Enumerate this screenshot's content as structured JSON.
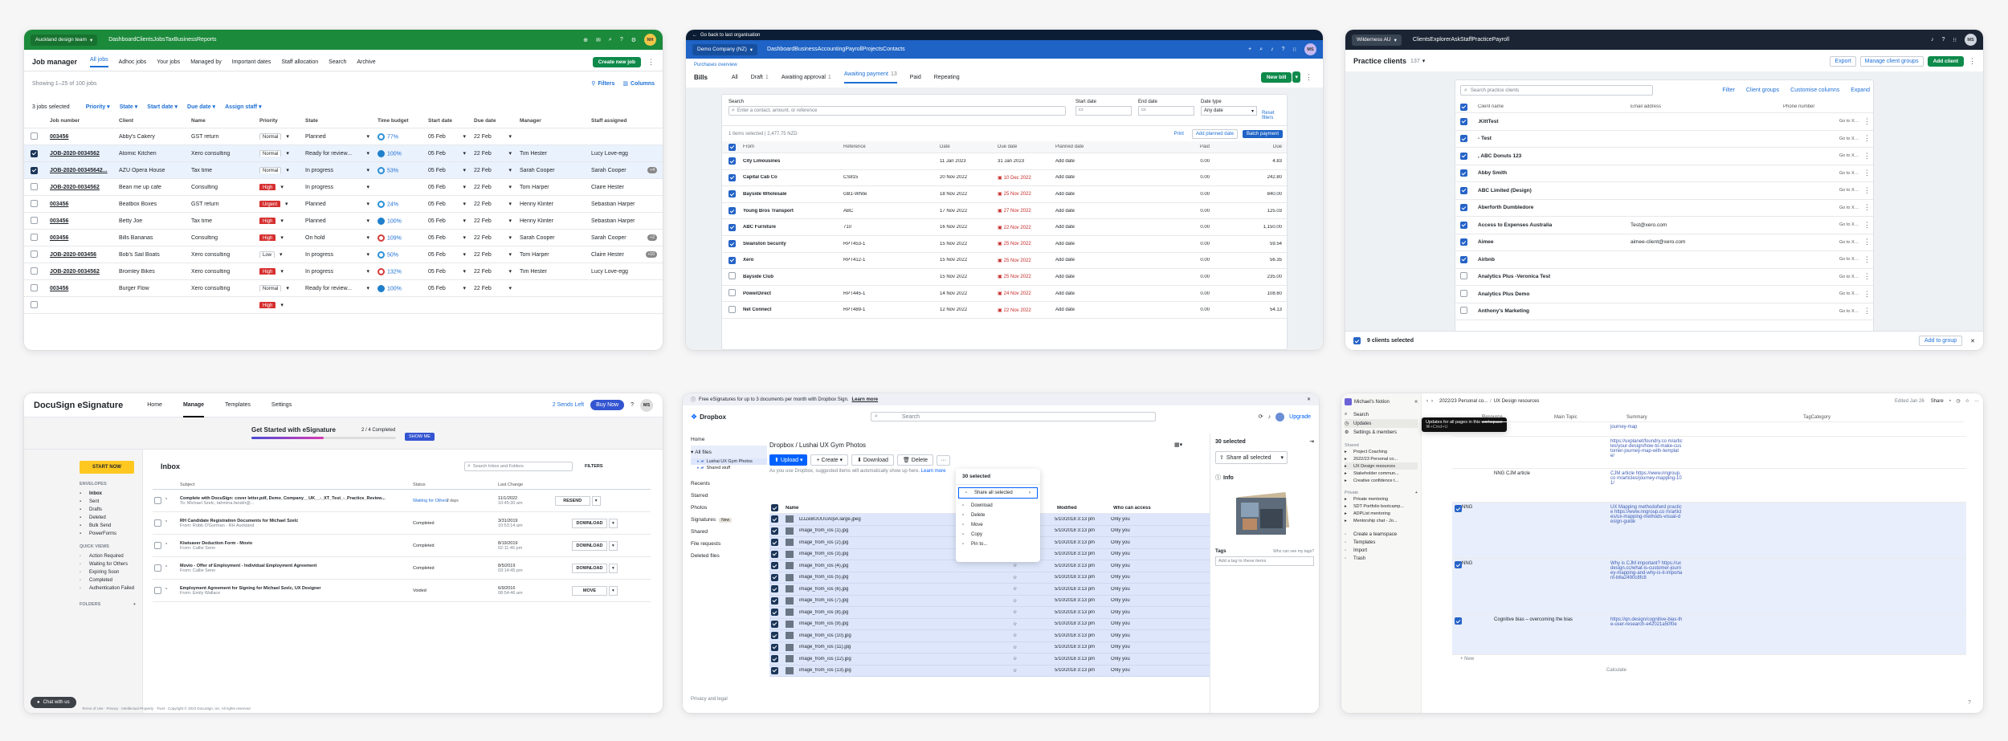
{
  "jobs": {
    "org": "Auckland design team",
    "nav": [
      "Dashboard",
      "Clients",
      "Jobs",
      "Tax",
      "Business",
      "Reports"
    ],
    "avatar": "NH",
    "title": "Job manager",
    "tabs": [
      "All jobs",
      "Adhoc jobs",
      "Your jobs",
      "Managed by",
      "Important dates",
      "Staff allocation",
      "Search",
      "Archive"
    ],
    "create": "Create new job",
    "showing": "Showing 1–25 of 100 jobs",
    "filters": "Filters",
    "columns": "Columns",
    "selected": "3 jobs selected",
    "chips": [
      "Priority",
      "State",
      "Start date",
      "Due date",
      "Assign staff"
    ],
    "headers": [
      "Job number",
      "Client",
      "Name",
      "Priority",
      "State",
      "Time budget",
      "Start date",
      "Due date",
      "Manager",
      "Staff assigned"
    ],
    "rows": [
      {
        "on": false,
        "num": "003456",
        "client": "Abby's Cakery",
        "name": "GST return",
        "prio": "Normal",
        "red": false,
        "state": "Planned",
        "tb": "77%",
        "ring": "",
        "start": "05 Feb",
        "due": "22 Feb",
        "mgr": "",
        "staff": "",
        "extra": ""
      },
      {
        "on": true,
        "num": "JOB-2020-0034562",
        "client": "Atomic Kitchen",
        "name": "Xero consulting",
        "prio": "Normal",
        "red": false,
        "state": "Ready for review...",
        "tb": "100%",
        "ring": "full",
        "start": "05 Feb",
        "due": "22 Feb",
        "mgr": "Tim Hester",
        "staff": "Lucy Love-egg",
        "extra": ""
      },
      {
        "on": true,
        "num": "JOB-2020-00345642...",
        "client": "AZU Opera House",
        "name": "Tax time",
        "prio": "Normal",
        "red": false,
        "state": "In progress",
        "tb": "53%",
        "ring": "",
        "start": "05 Feb",
        "due": "22 Feb",
        "mgr": "Sarah Cooper",
        "staff": "Sarah Cooper",
        "extra": "+4"
      },
      {
        "on": false,
        "num": "JOB-2020-0034562",
        "client": "Bean me up cafe",
        "name": "Consulting",
        "prio": "High",
        "red": true,
        "state": "In progress",
        "tb": "",
        "ring": "",
        "start": "05 Feb",
        "due": "22 Feb",
        "mgr": "Tom Harper",
        "staff": "Claire Hester",
        "extra": ""
      },
      {
        "on": false,
        "num": "003456",
        "client": "Beatbox Boxes",
        "name": "GST return",
        "prio": "Urgent",
        "red": true,
        "state": "Planned",
        "tb": "24%",
        "ring": "",
        "start": "05 Feb",
        "due": "22 Feb",
        "mgr": "Henny Klinter",
        "staff": "Sebastian Harper",
        "extra": ""
      },
      {
        "on": false,
        "num": "003456",
        "client": "Betty Joe",
        "name": "Tax time",
        "prio": "High",
        "red": true,
        "state": "Planned",
        "tb": "100%",
        "ring": "full",
        "start": "05 Feb",
        "due": "22 Feb",
        "mgr": "Henny Klinter",
        "staff": "Sebastian Harper",
        "extra": ""
      },
      {
        "on": false,
        "num": "003456",
        "client": "Bills Bananas",
        "name": "Consulting",
        "prio": "High",
        "red": true,
        "state": "On hold",
        "tb": "109%",
        "ring": "red",
        "start": "05 Feb",
        "due": "22 Feb",
        "mgr": "Sarah Cooper",
        "staff": "Sarah Cooper",
        "extra": "+2"
      },
      {
        "on": false,
        "num": "JOB-2020-003456",
        "client": "Bob's Sail Boats",
        "name": "Xero consulting",
        "prio": "Low",
        "red": false,
        "state": "In progress",
        "tb": "50%",
        "ring": "",
        "start": "05 Feb",
        "due": "22 Feb",
        "mgr": "Tom Harper",
        "staff": "Claire Hester",
        "extra": "+10"
      },
      {
        "on": false,
        "num": "JOB-2020-0034562",
        "client": "Bromley Bikes",
        "name": "Xero consulting",
        "prio": "High",
        "red": true,
        "state": "In progress",
        "tb": "132%",
        "ring": "red",
        "start": "05 Feb",
        "due": "22 Feb",
        "mgr": "Tim Hester",
        "staff": "Lucy Love-egg",
        "extra": ""
      },
      {
        "on": false,
        "num": "003456",
        "client": "Burger Flow",
        "name": "Xero consulting",
        "prio": "Normal",
        "red": false,
        "state": "Ready for review...",
        "tb": "100%",
        "ring": "full",
        "start": "05 Feb",
        "due": "22 Feb",
        "mgr": "",
        "staff": "",
        "extra": ""
      },
      {
        "on": false,
        "num": "",
        "client": "",
        "name": "",
        "prio": "High",
        "red": true,
        "state": "",
        "tb": "",
        "ring": "",
        "start": "",
        "due": "",
        "mgr": "",
        "staff": "",
        "extra": ""
      }
    ]
  },
  "bills": {
    "back": "Go back to last organisation",
    "org": "Demo Company (NZ)",
    "nav": [
      "Dashboard",
      "Business",
      "Accounting",
      "Payroll",
      "Projects",
      "Contacts"
    ],
    "avatar": "MS",
    "crumb": "Purchases overview",
    "title": "Bills",
    "newbill": "New bill",
    "tabs": [
      "All",
      "Draft",
      "Awaiting approval",
      "Awaiting payment",
      "Paid",
      "Repeating"
    ],
    "counts": [
      "",
      "1",
      "1",
      "13",
      "",
      ""
    ],
    "search_label": "Search",
    "search_ph": "Enter a contact, amount, or reference",
    "start": "Start date",
    "end": "End date",
    "datetype": "Date type",
    "anydate": "Any date",
    "reset": "Reset filters",
    "selinfo": "1 items selected | 2,477.75 NZD",
    "print": "Print",
    "addplanned": "Add planned date",
    "batch": "Batch payment",
    "headers": [
      "From",
      "Reference",
      "Date",
      "Due date",
      "Planned date",
      "Paid",
      "Due"
    ],
    "rows": [
      {
        "on": true,
        "from": "City Limousines",
        "ref": "",
        "date": "11 Jan 2023",
        "due": "31 Jan 2023",
        "late": false,
        "paid": "0.00",
        "amt": "4.83"
      },
      {
        "on": true,
        "from": "Capital Cab Co",
        "ref": "CS815",
        "date": "20 Nov 2022",
        "due": "10 Dec 2022",
        "late": true,
        "paid": "0.00",
        "amt": "242.80"
      },
      {
        "on": true,
        "from": "Bayside Wholesale",
        "ref": "GB1-White",
        "date": "18 Nov 2022",
        "due": "25 Nov 2022",
        "late": true,
        "paid": "0.00",
        "amt": "840.00"
      },
      {
        "on": true,
        "from": "Young Bros Transport",
        "ref": "ABC",
        "date": "17 Nov 2022",
        "due": "27 Nov 2022",
        "late": true,
        "paid": "0.00",
        "amt": "125.03"
      },
      {
        "on": true,
        "from": "ABC Furniture",
        "ref": "710",
        "date": "16 Nov 2022",
        "due": "22 Nov 2022",
        "late": true,
        "paid": "0.00",
        "amt": "1,150.00"
      },
      {
        "on": true,
        "from": "Swanston Security",
        "ref": "RPT453-1",
        "date": "15 Nov 2022",
        "due": "25 Nov 2022",
        "late": true,
        "paid": "0.00",
        "amt": "59.54"
      },
      {
        "on": true,
        "from": "Xero",
        "ref": "RPT412-1",
        "date": "15 Nov 2022",
        "due": "25 Nov 2022",
        "late": true,
        "paid": "0.00",
        "amt": "56.35"
      },
      {
        "on": false,
        "from": "Bayside Club",
        "ref": "",
        "date": "15 Nov 2022",
        "due": "25 Nov 2022",
        "late": true,
        "paid": "0.00",
        "amt": "235.00"
      },
      {
        "on": false,
        "from": "PowerDirect",
        "ref": "RPT445-1",
        "date": "14 Nov 2022",
        "due": "24 Nov 2022",
        "late": true,
        "paid": "0.00",
        "amt": "108.60"
      },
      {
        "on": false,
        "from": "Net Connect",
        "ref": "RPT489-1",
        "date": "12 Nov 2022",
        "due": "22 Nov 2022",
        "late": true,
        "paid": "0.00",
        "amt": "54.13"
      }
    ],
    "addtext": "Add date"
  },
  "practice": {
    "org": "Wilderness AU",
    "nav": [
      "Clients",
      "Explorer",
      "Ask",
      "Staff",
      "Practice",
      "Payroll"
    ],
    "avatar": "MS",
    "title": "Practice clients",
    "count": "137",
    "export": "Export",
    "manage": "Manage client groups",
    "addclient": "Add client",
    "search_ph": "Search practice clients",
    "filter": "Filter",
    "groups": "Client groups",
    "custom": "Customise columns",
    "expand": "Expand",
    "headers": [
      "Client name",
      "Email address",
      "Phone number"
    ],
    "rows": [
      {
        "on": true,
        "name": ".KittTest",
        "email": ""
      },
      {
        "on": true,
        "name": "- Test",
        "email": ""
      },
      {
        "on": true,
        "name": ", ABC Donuts 123",
        "email": ""
      },
      {
        "on": true,
        "name": "Abby Smith",
        "email": ""
      },
      {
        "on": true,
        "name": "ABC Limited (Design)",
        "email": ""
      },
      {
        "on": true,
        "name": "Aberforth Dumbledore",
        "email": ""
      },
      {
        "on": true,
        "name": "Access to Expenses Australia",
        "email": "Test@xero.com"
      },
      {
        "on": true,
        "name": "Aimee",
        "email": "aimee-client@xero.com"
      },
      {
        "on": true,
        "name": "Airbnb",
        "email": ""
      },
      {
        "on": false,
        "name": "Analytics Plus -Veronica Test",
        "email": ""
      },
      {
        "on": false,
        "name": "Analytics Plus Demo",
        "email": ""
      },
      {
        "on": false,
        "name": "Anthony's Marketing",
        "email": ""
      }
    ],
    "goto": "Go to Xero",
    "footer": "9 clients selected",
    "addgroup": "Add to group"
  },
  "docusign": {
    "logo": "DocuSign eSignature",
    "nav": [
      "Home",
      "Manage",
      "Templates",
      "Settings"
    ],
    "sends": "2 Sends Left",
    "buy": "Buy Now",
    "avatar": "MS",
    "getstarted": "Get Started with eSignature",
    "progress": "2 / 4 Completed",
    "show": "SHOW ME",
    "start": "START NOW",
    "envelopes": "ENVELOPES",
    "env_items": [
      "Inbox",
      "Sent",
      "Drafts",
      "Deleted",
      "Bulk Send",
      "PowerForms"
    ],
    "quick": "QUICK VIEWS",
    "quick_items": [
      "Action Required",
      "Waiting for Others",
      "Expiring Soon",
      "Completed",
      "Authentication Failed"
    ],
    "folders": "FOLDERS",
    "inbox": "Inbox",
    "search_ph": "Search Inbox and Folders",
    "filters": "FILTERS",
    "headers": [
      "Subject",
      "Status",
      "Last Change"
    ],
    "rows": [
      {
        "subject": "Complete with DocuSign: cover letter.pdf, Demo_Company__UK__-_XT_Test_-_Practice_Review...",
        "from": "To: Michael Szelc, tahmina.farukh@...",
        "status": "",
        "sub": "Waiting for Others",
        "date": "11/1/2022",
        "time": "10:45:30 am",
        "action": "RESEND",
        "warn": "2 days"
      },
      {
        "subject": "RH Candidate Registration Documents for Michael Szelc",
        "from": "From: Robb O'Gorman - RH Auckland",
        "status": "Completed",
        "sub": "",
        "date": "3/31/2019",
        "time": "10:53:14 am",
        "action": "DOWNLOAD",
        "warn": ""
      },
      {
        "subject": "Kiwisaver Deduction Form - Movio",
        "from": "From: Callie Senn",
        "status": "Completed",
        "sub": "",
        "date": "8/19/2019",
        "time": "02:11:46 pm",
        "action": "DOWNLOAD",
        "warn": ""
      },
      {
        "subject": "Movio - Offer of Employment - Individual Employment Agreement",
        "from": "From: Callie Senn",
        "status": "Completed",
        "sub": "",
        "date": "8/5/2019",
        "time": "03:14:45 pm",
        "action": "DOWNLOAD",
        "warn": ""
      },
      {
        "subject": "Employment Agreement for Signing for Michael Szelc, UX Designer",
        "from": "From: Emily Wallace",
        "status": "Voided",
        "sub": "",
        "date": "6/9/2016",
        "time": "08:54:46 am",
        "action": "MOVE",
        "warn": ""
      }
    ],
    "chat": "Chat with us",
    "footer": "Terms of Use · Privacy · Intellectual Property · Trust · Copyright © 2023 DocuSign, Inc. All rights reserved"
  },
  "dropbox": {
    "banner": "Free eSignatures for up to 3 documents per month with Dropbox Sign.",
    "learn": "Learn more",
    "logo": "Dropbox",
    "search_ph": "Search",
    "upgrade": "Upgrade",
    "side": [
      "Home",
      "All files",
      "Recents",
      "Starred",
      "Photos",
      "Signatures",
      "Shared",
      "File requests",
      "Deleted files"
    ],
    "newbadge": "New",
    "tree": [
      "Lushai UX Gym Photos",
      "Shared stuff"
    ],
    "privacy": "Privacy and legal",
    "crumb": "Dropbox / Lushai UX Gym Photos",
    "upload": "Upload",
    "create": "Create",
    "download": "Download",
    "delete": "Delete",
    "hint": "As you use Dropbox, suggested items will automatically show up here.",
    "learnmore": "Learn more",
    "selected": "30 selected",
    "menu": [
      "Share all selected",
      "Download",
      "Delete",
      "Move",
      "Copy",
      "Pin to..."
    ],
    "headers": [
      "Name",
      "Modified",
      "Who can access"
    ],
    "files": [
      "DJZeBUUUUA/pA.large.jpeg",
      "image_from_ios (1).jpg",
      "image_from_ios (2).jpg",
      "image_from_ios (3).jpg",
      "image_from_ios (4).jpg",
      "image_from_ios (5).jpg",
      "image_from_ios (6).jpg",
      "image_from_ios (7).jpg",
      "image_from_ios (8).jpg",
      "image_from_ios (9).jpg",
      "image_from_ios (10).jpg",
      "image_from_ios (11).jpg",
      "image_from_ios (12).jpg",
      "image_from_ios (13).jpg"
    ],
    "modified": "5/10/2018 3:13 pm",
    "access": "Only you",
    "panel_title": "30 selected",
    "share_all": "Share all selected",
    "info": "Info",
    "tags": "Tags",
    "tags_q": "Who can see my tags?",
    "tag_ph": "Add a tag to these items"
  },
  "notion": {
    "workspace": "Michael's Notion",
    "crumb": [
      "2022/23 Personal co...",
      "UX Design resources"
    ],
    "edited": "Edited Jan 26",
    "share": "Share",
    "side": [
      "Search",
      "Updates",
      "Settings & members"
    ],
    "tooltip": "Updates for all pages in this workspace",
    "tooltip_sub": "⌘+Cmd+U",
    "shared": "Shared",
    "shared_items": [
      "Project Coaching",
      "2022/23 Personal co...",
      "UX Design resources",
      "Stakeholder commun...",
      "Creative confidence t..."
    ],
    "private": "Private",
    "private_items": [
      "Private mentoring",
      "SDT Portfolio bootcamp...",
      "ADPList mentoring",
      "Mentorship chat - Jo..."
    ],
    "bottom": [
      "Create a teamspace",
      "Templates",
      "Import",
      "Trash"
    ],
    "cols": [
      "Resource",
      "Main Topic",
      "Summary",
      "TagCategory"
    ],
    "rows": [
      {
        "tag": "",
        "main": "",
        "sum": "journey-map"
      },
      {
        "tag": "",
        "main": "",
        "sum": "https://uxplanet/foundry.co m/articles/your-design/how-to-make-customer-journey-map-with-template/"
      },
      {
        "tag": "",
        "main": "NNG CJM article",
        "sum": "CJM article https://www.nngroup.co m/articles/journey-mapping-101/"
      },
      {
        "tag": "NNG",
        "main": "",
        "sum": "UX Mapping methodofwrd practice https://www.nngroup.co m/articles/ux-mapping-methods-visual-design-guide"
      },
      {
        "tag": "NNG",
        "main": "",
        "sum": "Why is CJM important? https://uxdesign.cc/what-is-customer-journey-mapping-and-why-is-it-important-b6a2490c8fc8"
      },
      {
        "tag": "",
        "main": "Cognitive bias – overcoming the bias",
        "sum": "https://qn.design/cognitive-bias-the-user-research-e42021a50f0e"
      }
    ],
    "new": "+ New",
    "calc": "Calculate"
  }
}
